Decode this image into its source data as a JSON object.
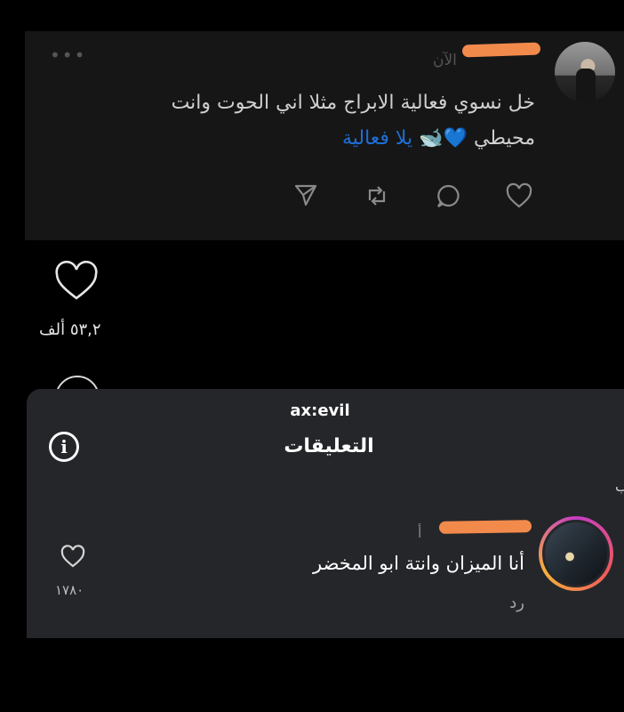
{
  "tweet": {
    "time": "الآن",
    "more_icon": "more-icon",
    "text_line1": "خل نسوي فعالية الابراج مثلا اني الحوت وانت",
    "text_line2": "محيطي",
    "emojis": "💙🐋",
    "hashtag": "يلا فعالية",
    "actions": [
      "share-icon",
      "retweet-icon",
      "reply-icon",
      "like-icon"
    ]
  },
  "reel": {
    "like_count": "٥٣,٢ ألف"
  },
  "comments_sheet": {
    "watermark": "ax:evil",
    "title": "التعليقات",
    "comment": {
      "meta": "أ",
      "text": "أنا الميزان وانتة ابو المخضر",
      "reply_label": "رد",
      "like_count": "١٧٨٠"
    }
  },
  "colors": {
    "redaction": "#f28a4c",
    "hashtag": "#1d6fd6",
    "sheet_bg": "#25262a",
    "tweet_bg": "#161616"
  }
}
